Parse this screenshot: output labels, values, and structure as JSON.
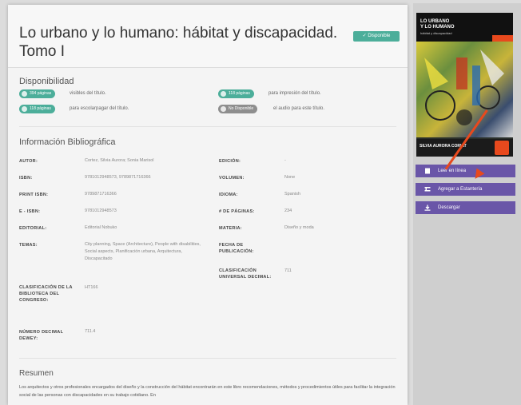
{
  "book": {
    "title": "Lo urbano y lo humano: hábitat y discapacidad. Tomo I",
    "status_badge": "✓ Disponible"
  },
  "availability": {
    "heading": "Disponibilidad",
    "items": [
      {
        "pill": "394 páginas",
        "text": "visibles del título.",
        "style": "green"
      },
      {
        "pill": "118 páginas",
        "text": "para impresión del título.",
        "style": "green"
      },
      {
        "pill": "118 páginas",
        "text": "para escolarpagar del título.",
        "style": "green"
      },
      {
        "pill": "No Disponible",
        "text": "el audio para este título.",
        "style": "gray"
      }
    ]
  },
  "biblio": {
    "heading": "Información Bibliográfica",
    "left": [
      {
        "label": "AUTOR:",
        "value": "Cortez, Silvia Aurora; Sonia Marisol"
      },
      {
        "label": "ISBN:",
        "value": "9781012948573, 9789871716366"
      },
      {
        "label": "PRINT ISBN:",
        "value": "9789871716366"
      },
      {
        "label": "E - ISBN:",
        "value": "9781012948573"
      },
      {
        "label": "EDITORIAL:",
        "value": "Editorial Nobuko"
      },
      {
        "label": "TEMAS:",
        "value": "City planning, Space (Architecture), People with disabilities, Social aspects, Planificación urbana, Arquitectura, Discapacitado"
      },
      {
        "label": "CLASIFICACIÓN DE LA BIBLIOTECA DEL CONGRESO:",
        "value": "HT166"
      },
      {
        "label": "NÚMERO DECIMAL DEWEY:",
        "value": "711.4"
      }
    ],
    "right": [
      {
        "label": "EDICIÓN:",
        "value": "-"
      },
      {
        "label": "VOLUMEN:",
        "value": "None"
      },
      {
        "label": "IDIOMA:",
        "value": "Spanish"
      },
      {
        "label": "# DE PÁGINAS:",
        "value": "234"
      },
      {
        "label": "MATERIA:",
        "value": "Diseño y moda"
      },
      {
        "label": "FECHA DE PUBLICACIÓN:",
        "value": ""
      },
      {
        "label": "CLASIFICACIÓN UNIVERSAL DECIMAL:",
        "value": "711"
      }
    ]
  },
  "summary": {
    "heading": "Resumen",
    "text": "Los arquitectos y otros profesionales encargados del diseño y la construcción del hábitat encontrarán en este libro recomendaciones, métodos y procedimientos útiles para facilitar la integración social de las personas con discapacidades en su trabajo cotidiano. En"
  },
  "cover": {
    "title_line1": "LO URBANO",
    "title_line2": "Y LO HUMANO",
    "subtitle": "hábitat y discapacidad",
    "author": "SILVIA AURORA CORIAT"
  },
  "actions": [
    {
      "label": "Leer en línea",
      "icon": "book-icon"
    },
    {
      "label": "Agregar a Estantería",
      "icon": "shelf-icon"
    },
    {
      "label": "Descargar",
      "icon": "download-icon"
    }
  ],
  "colors": {
    "accent_green": "#4cae9a",
    "button_purple": "#6a56a8",
    "arrow_orange": "#e8491d"
  }
}
